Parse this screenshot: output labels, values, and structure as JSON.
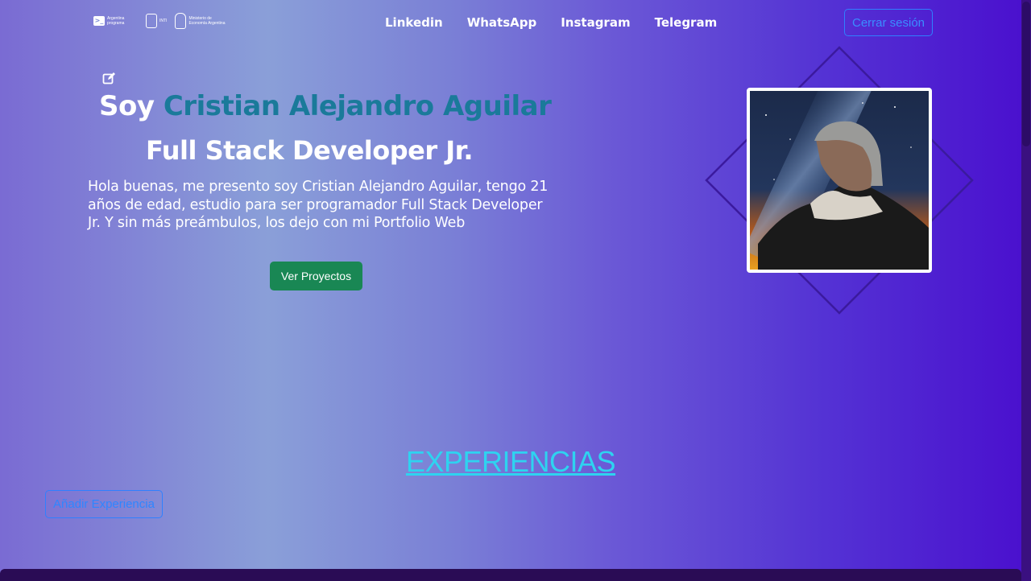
{
  "header": {
    "logos": [
      {
        "name": "argentina-programa-logo",
        "text": "Argentina programa"
      },
      {
        "name": "inti-logo",
        "text": "INTI"
      },
      {
        "name": "ministerio-logo",
        "text": "Ministerio de Economía Argentina"
      }
    ],
    "nav": [
      {
        "label": "Linkedin"
      },
      {
        "label": "WhatsApp"
      },
      {
        "label": "Instagram"
      },
      {
        "label": "Telegram"
      }
    ],
    "logout_label": "Cerrar sesión"
  },
  "hero": {
    "greeting": "Soy",
    "name": "Cristian Alejandro Aguilar",
    "role": "Full Stack Developer Jr.",
    "bio": "Hola buenas, me presento soy Cristian Alejandro Aguilar, tengo 21 años de edad, estudio para ser programador Full Stack Developer Jr. Y sin más preámbulos, los dejo con mi Portfolio Web",
    "cta_label": "Ver Proyectos",
    "edit_icon": "edit-icon"
  },
  "experiences": {
    "title": "EXPERIENCIAS",
    "add_label": "Añadir Experiencia"
  },
  "colors": {
    "name_accent": "#1a7a9a",
    "cta_green": "#198754",
    "outline_blue": "#2f80ff",
    "section_title": "#2ed3f0"
  }
}
